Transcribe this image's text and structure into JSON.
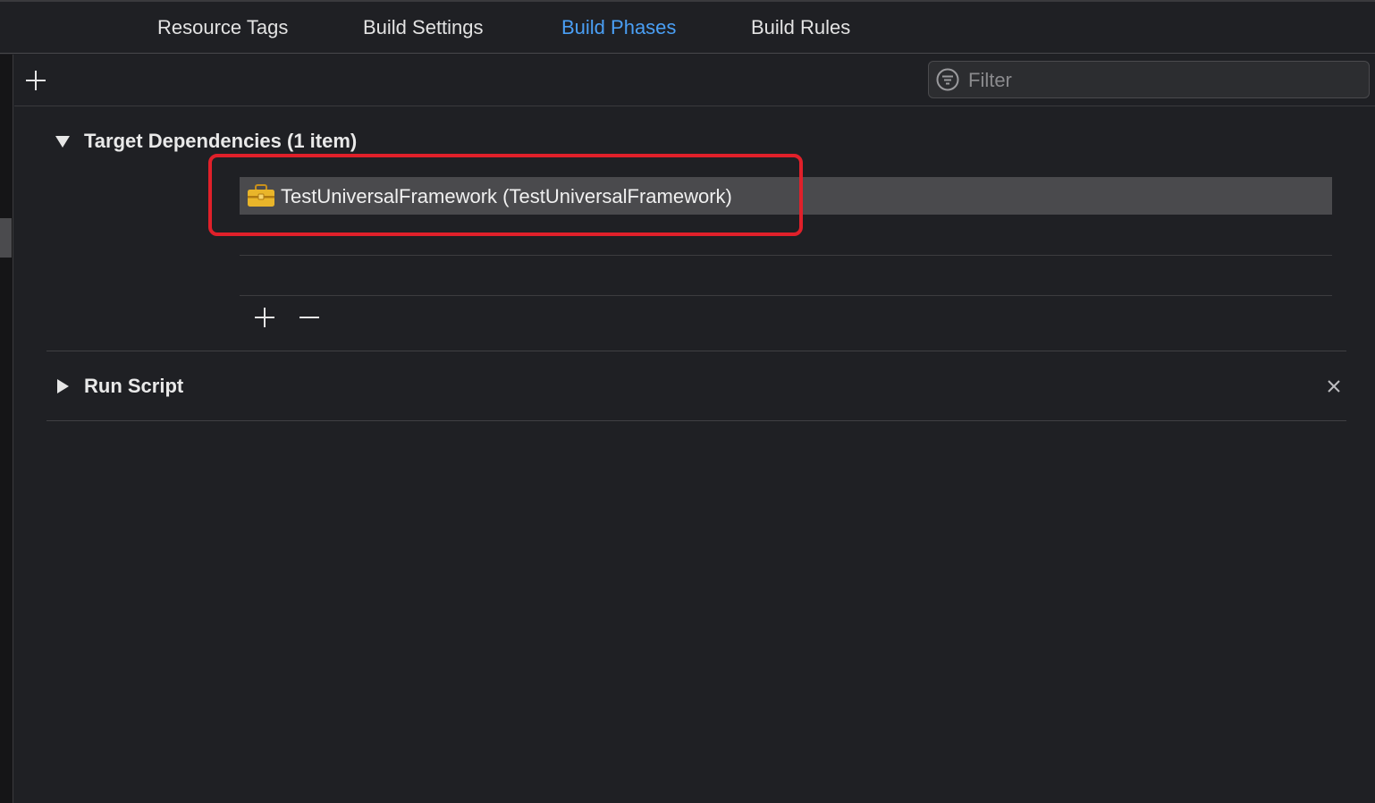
{
  "tabs": [
    {
      "label": "Resource Tags"
    },
    {
      "label": "Build Settings"
    },
    {
      "label": "Build Phases"
    },
    {
      "label": "Build Rules"
    }
  ],
  "active_tab": "Build Phases",
  "filter": {
    "placeholder": "Filter",
    "value": ""
  },
  "phases": {
    "target_dependencies": {
      "title": "Target Dependencies (1 item)",
      "expanded": true,
      "items": [
        {
          "label": "TestUniversalFramework (TestUniversalFramework)",
          "icon": "toolbox-icon"
        }
      ]
    },
    "run_script": {
      "title": "Run Script",
      "expanded": false
    }
  },
  "colors": {
    "background": "#1f2024",
    "accent": "#4a9ff5",
    "selected_row": "#4a4a4d",
    "highlight_box": "#e0202a",
    "toolbox": "#e9b52a"
  }
}
